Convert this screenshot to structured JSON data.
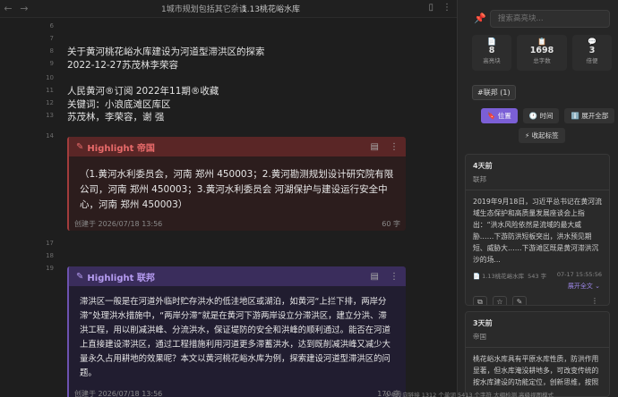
{
  "tabs": {
    "folder": "1城市规划包括其它杂谈",
    "separator": "/",
    "file": "1.13桃花峪水库"
  },
  "editor": {
    "lines": [
      {
        "n": "6",
        "text": ""
      },
      {
        "n": "7",
        "text": "关于黄河桃花峪水库建设为河道型滞洪区的探索"
      },
      {
        "n": "8",
        "text": "2022-12-27苏茂林李荣容"
      },
      {
        "n": "9",
        "text": ""
      },
      {
        "n": "10",
        "text": "人民黄河®订阅 2022年11期®收藏"
      },
      {
        "n": "11",
        "text": "关键词：小浪底滩区库区"
      },
      {
        "n": "12",
        "text": "苏茂林，李荣容，谢 强"
      },
      {
        "n": "13",
        "text": ""
      },
      {
        "n": "14",
        "text": ""
      }
    ],
    "highlight1": {
      "title": "Highlight 帝国",
      "body": "（1.黄河水利委员会，河南 郑州 450003；2.黄河勘测规划设计研究院有限公司，河南 郑州 450003；3.黄河水利委员会 河湖保护与建设运行安全中心，河南 郑州 450003）",
      "created": "创建于 2026/07/18 13:56",
      "count": "60 字"
    },
    "lines2": [
      "17",
      "18",
      "19"
    ],
    "highlight2": {
      "title": "Highlight 联邦",
      "body": "滞洪区一般是在河道外临时贮存洪水的低洼地区或湖泊，如黄河“上拦下排，两岸分滞”处理洪水措施中，“两岸分滞”就是在黄河下游两岸设立分滞洪区，建立分洪、滞洪工程，用以削减洪峰、分流洪水，保证堤防的安全和洪峰的顺利通过。能否在河道上直接建设滞洪区，通过工程措施利用河道更多滞蓄洪水，达到既削减洪峰又减少大量永久占用耕地的效果呢？本文以黄河桃花峪水库为例，探索建设河道型滞洪区的问题。",
      "created": "创建于 2026/07/18 13:56",
      "count": "170 字"
    }
  },
  "panel": {
    "search_placeholder": "搜索高亮块...",
    "stats": [
      {
        "icon": "📄",
        "num": "8",
        "label": "高亮块"
      },
      {
        "icon": "📋",
        "num": "1698",
        "label": "总字数"
      },
      {
        "icon": "💬",
        "num": "3",
        "label": "倍便"
      }
    ],
    "tag": "#联邦 (1)",
    "buttons": [
      {
        "label": "🔖 位置",
        "active": true
      },
      {
        "label": "🕐 时间",
        "active": false
      },
      {
        "label": "ℹ️ 展开全部",
        "active": false
      },
      {
        "label": "⚡ 收起标签",
        "active": false
      }
    ],
    "card1": {
      "ago": "4天前",
      "src": "联邦",
      "excerpt": "2019年9月18日，习近平总书记在黄河流域生态保护和高质量发展座谈会上指出：“洪水风险依然是流域的最大威胁……下游防洪短板突出，洪水预见期短、威胁大……下游滩区既是黄河滞洪沉沙的场...",
      "file": "📄 1.13桃花峪水库",
      "chars": "543 字",
      "time": "07-17 15:55:56",
      "expand": "展开全文 ⌄"
    },
    "card2": {
      "ago": "3天前",
      "src": "帝国",
      "excerpt": "桃花峪水库具有平原水库性质，防洪作用显著，但水库淹没耕地多，可改变传统的按水库建设的功能定位，创新思维，按照"
    },
    "status": "0 条反向链接   1312 个单词   5413 个字符   大纲检测   高级视图模式"
  }
}
